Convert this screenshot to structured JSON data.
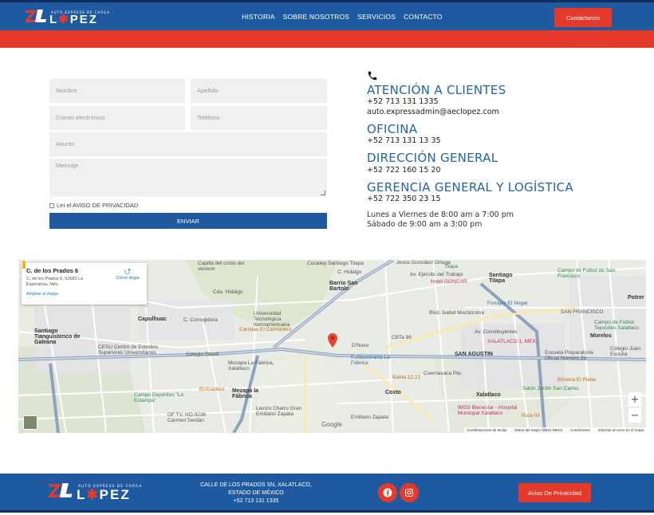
{
  "header": {
    "logo": {
      "mark": "ZL",
      "tagline": "AUTO EXPRESS DE CARGA",
      "name_left": "L",
      "name_right": "PEZ"
    },
    "nav": [
      "HISTORIA",
      "SOBRE NOSOTROS",
      "SERVICIOS",
      "CONTACTO"
    ],
    "contact_button": "Contáctanos"
  },
  "form": {
    "nombre_placeholder": "Nombre",
    "apellido_placeholder": "Apellido",
    "correo_placeholder": "Correo electrónico",
    "telefono_placeholder": "Teléfono",
    "asunto_placeholder": "Asunto",
    "mensaje_placeholder": "Mensaje",
    "privacy_label": "Leí el AVISO DE PRIVACIDAD",
    "submit_label": "ENVIAR"
  },
  "contact": {
    "atencion_title": "ATENCIÓN A CLIENTES",
    "atencion_phone": "+52 713 131 1335",
    "atencion_email": "auto.expressadmin@aeclopez.com",
    "oficina_title": "OFICINA",
    "oficina_phone": "+52 713 131 13 35",
    "direccion_title": "DIRECCIÓN GENERAL",
    "direccion_phone": "+52 722 160 15 20",
    "gerencia_title": "GERENCIA GENERAL Y LOGÍSTICA",
    "gerencia_phone": "+52 722 350 23 15",
    "hours_weekday": "Lunes a Viernes de 8:00 am a 7:00 pm",
    "hours_saturday": "Sábado de 9:00 am a 3:00 pm"
  },
  "map": {
    "card_title": "C. de los Prados 6",
    "card_address": "C. de los Prados 6, 52683 La Esperanza, Méx.",
    "card_link": "Ampliar el mapa",
    "directions": "Cómo llegar",
    "labels": {
      "capilla": "Capilla del cristo del veneno",
      "conalep": "Conalep Santiago Tilapa",
      "barrio": "Barrio San Bartolo",
      "santiago_tilapa": "Santiago Tilapa",
      "gonzar": "Hotel GONCAR",
      "tilapa": "Tilapa",
      "campo_futbol": "Campo de Futbol de San Francisco",
      "forrajes": "Forrajes El Nogal",
      "potrero": "Potrer",
      "capulhuac": "Capulhuac",
      "univ": "Universidad Tecnológica Iberoamericana",
      "carnitas": "Carnitas El Camionero",
      "san_francisco": "SAN FRANCISCO",
      "campo_tejocotes": "Campo de Fútbol Tejocotes Xalatlaco",
      "santiago_tianguistenco": "Santiago Tianguistenco de Galeana",
      "cesu": "CESU Centro de Estudios Superiores Universitarios",
      "colegio_gaudi": "Colegio Gaudí",
      "dnovo": "D'Novo",
      "cbta": "CBTa 96",
      "xalatlaco_mex": "XALATLACO 1, MEX",
      "morelos": "Morelos",
      "colegio_juan": "Colegio Juan Escutia",
      "mezapa_fabrica_top": "Mezapa La Fábrica, Xalatlaco",
      "refaccionaria": "Refaccionaria La Fábrica",
      "san_agustin": "SAN AGUSTIN",
      "escuela": "Escuela Preparatoria Oficial Número 26",
      "bahia": "Bahía 12:21",
      "bimeria": "Bimeria El Plebe",
      "salon": "Salón Jardín San Carlos",
      "campo_deportivo": "Campo Deportivo \"La Estampa\"",
      "el_asadero": "El Asadero",
      "mezapa_fabrica": "Mezapa la Fábrica",
      "coxto": "Coxto",
      "xalatlaco": "Xalatlaco",
      "imss": "IMSS Bienestar - Hospital Municipal Xalatlaco",
      "ruta": "Ruta 03",
      "of_tv": "OF TV. NO.0236 Carmen Serdán",
      "lienzo": "Lienzo Charro Gran Emiliano Zapata",
      "emiliano": "Emiliano Zapata",
      "google": "Google"
    },
    "roads": {
      "ejercito": "Av. Ejército del Trabajo",
      "isabel": "Blvd. Isabel Moctezuma",
      "constituyentes": "Av. Constituyentes",
      "corregidora": "C. Corregidora",
      "cda_hidalgo": "Cda. Hidalgo",
      "c_hidalgo": "C. Hidalgo",
      "jesus_gonzalez": "Jesús González Ortega",
      "cuernavaca": "Cuernavaca Pte.",
      "calle_ix": "C. Hidalgo",
      "route_6": "6"
    },
    "footer_items": [
      "Combinaciones de teclas",
      "Datos del mapa ©2024 INEGI",
      "Condiciones",
      "Informar un error en el mapa"
    ],
    "zoom_in": "+",
    "zoom_out": "−"
  },
  "footer": {
    "logo": {
      "mark": "ZL",
      "tagline": "AUTO EXPRESS DE CARGA",
      "name_left": "L",
      "name_right": "PEZ"
    },
    "address_line1": "CALLE DE LOS PRADOS SN, XALATLACO,",
    "address_line2": "ESTADO DE MÉXICO",
    "address_phone": "+52 713 131 1335",
    "aviso_button": "Aviso De Privacidad"
  },
  "colors": {
    "brand_blue": "#1f5aa0",
    "brand_red": "#e53a2b",
    "heading_blue": "#2563a8"
  },
  "icons": [
    "phone-icon",
    "facebook-icon",
    "instagram-icon",
    "map-pin-icon",
    "directions-icon",
    "pegman-icon"
  ]
}
